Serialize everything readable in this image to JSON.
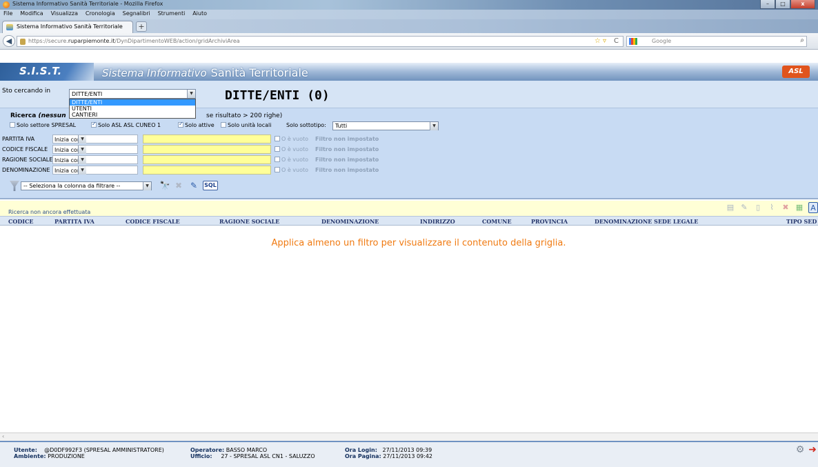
{
  "browser": {
    "window_title": "Sistema Informativo Sanità Territoriale - Mozilla Firefox",
    "menu": [
      "File",
      "Modifica",
      "Visualizza",
      "Cronologia",
      "Segnalibri",
      "Strumenti",
      "Aiuto"
    ],
    "tab_title": "Sistema Informativo Sanità Territoriale",
    "new_tab": "+",
    "url_prefix": "https://secure.",
    "url_domain": "ruparpiemonte.it",
    "url_path": "/DynDipartimentoWEB/action/gridArchiviArea",
    "search_placeholder": "Google",
    "win_min": "–",
    "win_max": "□",
    "win_close": "x"
  },
  "header": {
    "logo": "S.I.S.T.",
    "system_label": "Sistema Informativo",
    "system_name": "Sanità Territoriale",
    "asl_logo": "ASL"
  },
  "search": {
    "label": "Sto cercando in",
    "selected": "DITTE/ENTI",
    "options": [
      "DITTE/ENTI",
      "UTENTI",
      "CANTIERI"
    ],
    "title": "DITTE/ENTI (0)",
    "ricerca_label": "Ricerca",
    "ricerca_italic": "(nessun",
    "ricerca_rest": "se risultato > 200 righe)"
  },
  "filters": {
    "solo_settore": "Solo settore SPRESAL",
    "solo_asl": "Solo ASL ASL CUNEO 1",
    "solo_attive": "Solo attive",
    "solo_unita": "Solo unità locali",
    "sottotipo_label": "Solo sottotipo:",
    "sottotipo_value": "Tutti",
    "rows": [
      {
        "label": "PARTITA IVA",
        "op": "Inizia con",
        "vuoto": "O è vuoto",
        "status": "Filtro non impostato"
      },
      {
        "label": "CODICE FISCALE",
        "op": "Inizia con",
        "vuoto": "O è vuoto",
        "status": "Filtro non impostato"
      },
      {
        "label": "RAGIONE SOCIALE",
        "op": "Inizia con",
        "vuoto": "O è vuoto",
        "status": "Filtro non impostato"
      },
      {
        "label": "DENOMINAZIONE",
        "op": "Inizia con",
        "vuoto": "O è vuoto",
        "status": "Filtro non impostato"
      }
    ],
    "column_select": "-- Seleziona la colonna da filtrare --",
    "sql": "SQL"
  },
  "grid": {
    "status": "Ricerca non ancora effettuata",
    "columns": [
      "CODICE",
      "PARTITA IVA",
      "CODICE FISCALE",
      "RAGIONE SOCIALE",
      "DENOMINAZIONE",
      "INDIRIZZO",
      "COMUNE",
      "PROVINCIA",
      "DENOMINAZIONE SEDE LEGALE",
      "TIPO SED"
    ],
    "empty_message": "Applica almeno un filtro per visualizzare il contenuto della griglia.",
    "scroll_left": "‹"
  },
  "footer": {
    "utente_label": "Utente:",
    "utente_value": "@D0DF992F3 (SPRESAL AMMINISTRATORE)",
    "ambiente_label": "Ambiente:",
    "ambiente_value": "PRODUZIONE",
    "operatore_label": "Operatore:",
    "operatore_value": "BASSO MARCO",
    "ufficio_label": "Ufficio:",
    "ufficio_value": "27 - SPRESAL ASL CN1 - SALUZZO",
    "ora_login_label": "Ora Login:",
    "ora_login_value": "27/11/2013 09:39",
    "ora_pagina_label": "Ora Pagina:",
    "ora_pagina_value": "27/11/2013 09:42"
  },
  "colors": {
    "accent": "#3399ff",
    "empty_message": "#f07a11",
    "filter_value_bg": "#ffff99",
    "panel_bg": "#c8dbf3"
  }
}
